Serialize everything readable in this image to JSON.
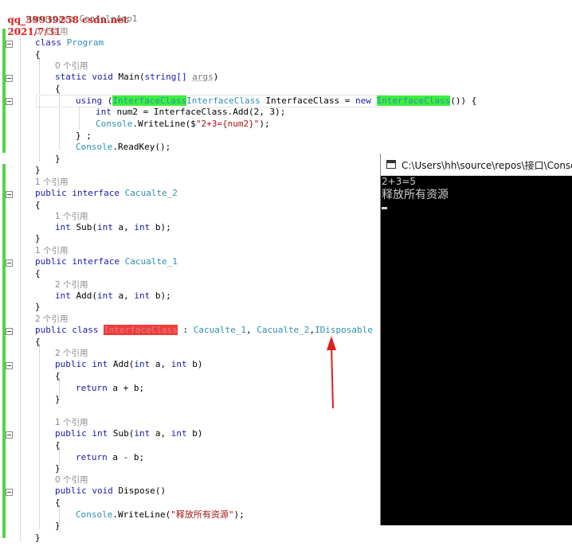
{
  "watermark": {
    "line1": "qq_39939258 csdn.net",
    "line1_overlay": "namespace ConsoleApp1",
    "line2": "2021/7/31"
  },
  "code": {
    "refs": {
      "r0": "0 个引用",
      "r1": "1 个引用",
      "r2": "2 个引用"
    },
    "class": "class",
    "program": "Program",
    "static": "static",
    "void": "void",
    "main": "Main(",
    "string_arr": "string[]",
    "args": "args",
    "close_paren": ")",
    "using": "using",
    "interface_class_type": "InterfaceClass",
    "interface_class_var": " InterfaceClass = ",
    "new": "new",
    "using_tail": "()) {",
    "int": "int",
    "num2_assign": " num2 = InterfaceClass.Add(2, 3);",
    "console": "Console",
    "writeline_open": ".WriteLine($",
    "str_2plus3": "\"2+3={num2}\"",
    "writeline_close": ");",
    "close_semicolon": "} ;",
    "readkey": ".ReadKey();",
    "public": "public",
    "interface": "interface",
    "cacualte2": "Cacualte_2",
    "cacualte1": "Cacualte_1",
    "sub_sig": " Sub(",
    "add_sig": " Add(",
    "a_param": " a, ",
    "b_param": " b);",
    "b_param_noend": " b)",
    "class_decl_tail": " : ",
    "comma": ", ",
    "idisposable": "IDisposable",
    "return_add": "return a + b;",
    "return_sub": "return a - b;",
    "dispose_sig": " Dispose()",
    "str_release": "\"释放所有资源\"",
    "brace_open": "{",
    "brace_close": "}"
  },
  "console_window": {
    "title": "C:\\Users\\hh\\source\\repos\\接口\\ConsoleA",
    "output_line1": "2+3=5",
    "output_line2": "释放所有资源"
  },
  "colors": {
    "accent_green": "#3cf03c",
    "accent_red": "#f03c3c",
    "arrow_red": "#e0201e"
  }
}
